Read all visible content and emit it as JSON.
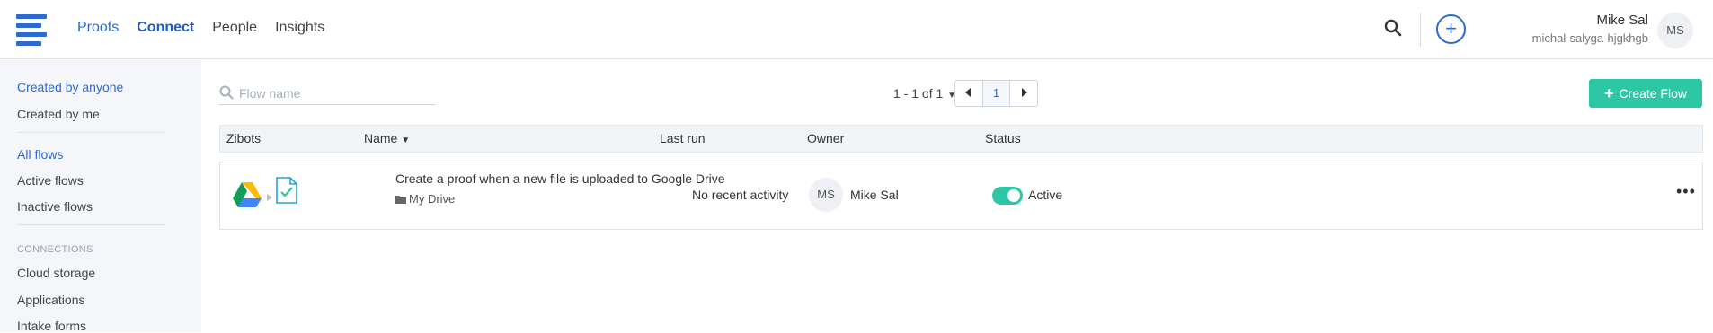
{
  "nav": {
    "items": [
      {
        "label": "Proofs"
      },
      {
        "label": "Connect"
      },
      {
        "label": "People"
      },
      {
        "label": "Insights"
      }
    ]
  },
  "user": {
    "name": "Mike Sal",
    "account": "michal-salyga-hjgkhgb",
    "initials": "MS"
  },
  "sidebar": {
    "created_by_anyone": "Created by anyone",
    "created_by_me": "Created by me",
    "all_flows": "All flows",
    "active_flows": "Active flows",
    "inactive_flows": "Inactive flows",
    "connections_heading": "CONNECTIONS",
    "cloud_storage": "Cloud storage",
    "applications": "Applications",
    "intake_forms": "Intake forms"
  },
  "search": {
    "placeholder": "Flow name"
  },
  "pagination": {
    "summary": "1 - 1 of 1",
    "current_page": "1"
  },
  "create_button": "Create Flow",
  "table": {
    "columns": {
      "zibots": "Zibots",
      "name": "Name",
      "last_run": "Last run",
      "owner": "Owner",
      "status": "Status"
    },
    "rows": [
      {
        "name": "Create a proof when a new file is uploaded to Google Drive",
        "folder": "My Drive",
        "last_run": "No recent activity",
        "owner_initials": "MS",
        "owner_name": "Mike Sal",
        "status": "Active"
      }
    ]
  },
  "colors": {
    "accent": "#2b6bd1",
    "success": "#2ec7a5",
    "sidebar_bg": "#f4f6f9"
  }
}
